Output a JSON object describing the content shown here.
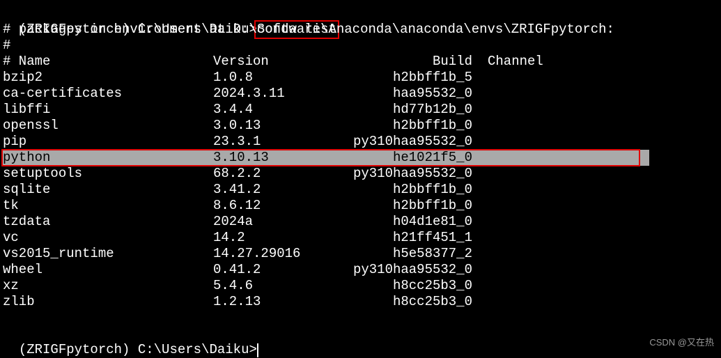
{
  "prompt1": {
    "prefix": "(ZRIGFpytorch) C:\\Users\\Daiku>",
    "command": "conda list"
  },
  "env_line": "# packages in environment at D:\\Software\\Anaconda\\anaconda\\envs\\ZRIGFpytorch:",
  "hash_line": "#",
  "headers": {
    "name": "# Name",
    "version": "Version",
    "build": "Build",
    "channel": "Channel"
  },
  "packages": [
    {
      "name": "bzip2",
      "version": "1.0.8",
      "build": "h2bbff1b_5",
      "channel": ""
    },
    {
      "name": "ca-certificates",
      "version": "2024.3.11",
      "build": "haa95532_0",
      "channel": ""
    },
    {
      "name": "libffi",
      "version": "3.4.4",
      "build": "hd77b12b_0",
      "channel": ""
    },
    {
      "name": "openssl",
      "version": "3.0.13",
      "build": "h2bbff1b_0",
      "channel": ""
    },
    {
      "name": "pip",
      "version": "23.3.1",
      "build": "py310haa95532_0",
      "channel": ""
    },
    {
      "name": "python",
      "version": "3.10.13",
      "build": "he1021f5_0",
      "channel": "",
      "highlight": true
    },
    {
      "name": "setuptools",
      "version": "68.2.2",
      "build": "py310haa95532_0",
      "channel": ""
    },
    {
      "name": "sqlite",
      "version": "3.41.2",
      "build": "h2bbff1b_0",
      "channel": ""
    },
    {
      "name": "tk",
      "version": "8.6.12",
      "build": "h2bbff1b_0",
      "channel": ""
    },
    {
      "name": "tzdata",
      "version": "2024a",
      "build": "h04d1e81_0",
      "channel": ""
    },
    {
      "name": "vc",
      "version": "14.2",
      "build": "h21ff451_1",
      "channel": ""
    },
    {
      "name": "vs2015_runtime",
      "version": "14.27.29016",
      "build": "h5e58377_2",
      "channel": ""
    },
    {
      "name": "wheel",
      "version": "0.41.2",
      "build": "py310haa95532_0",
      "channel": ""
    },
    {
      "name": "xz",
      "version": "5.4.6",
      "build": "h8cc25b3_0",
      "channel": ""
    },
    {
      "name": "zlib",
      "version": "1.2.13",
      "build": "h8cc25b3_0",
      "channel": ""
    }
  ],
  "prompt2": "(ZRIGFpytorch) C:\\Users\\Daiku>",
  "watermark": "CSDN @又在热"
}
